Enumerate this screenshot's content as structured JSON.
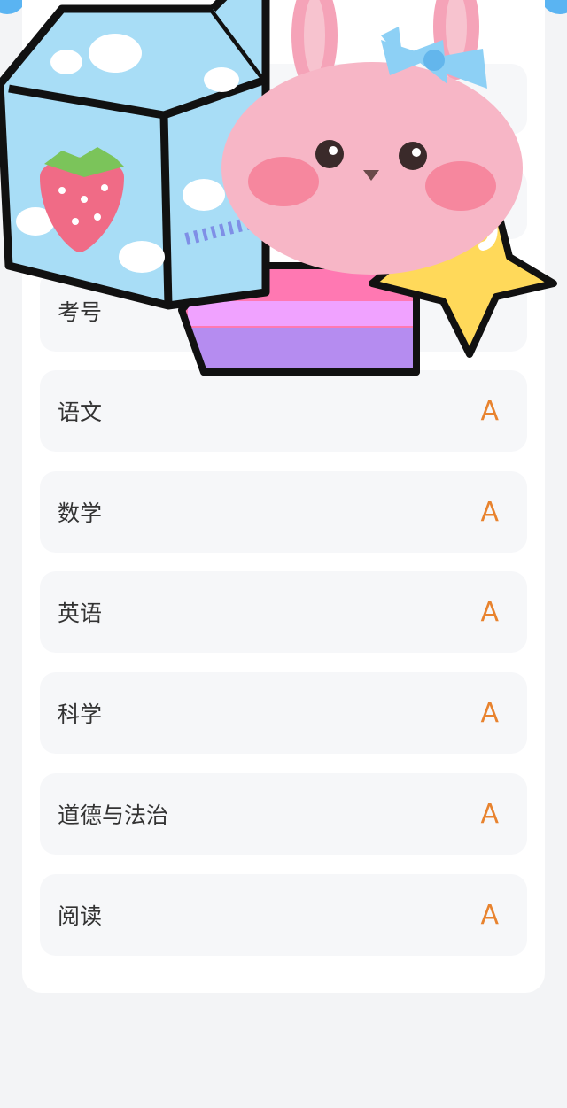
{
  "rows": [
    {
      "label": "考号",
      "grade": ""
    },
    {
      "label": "语文",
      "grade": "A"
    },
    {
      "label": "数学",
      "grade": "A"
    },
    {
      "label": "英语",
      "grade": "A"
    },
    {
      "label": "科学",
      "grade": "A"
    },
    {
      "label": "道德与法治",
      "grade": "A"
    },
    {
      "label": "阅读",
      "grade": "A"
    }
  ],
  "colors": {
    "grade": "#e8832f",
    "row_bg": "#f6f7f9",
    "accent_blue": "#5ab4f2"
  },
  "decorations": [
    "milk-carton-sticker",
    "bunny-sticker",
    "rainbow-star-sticker"
  ]
}
